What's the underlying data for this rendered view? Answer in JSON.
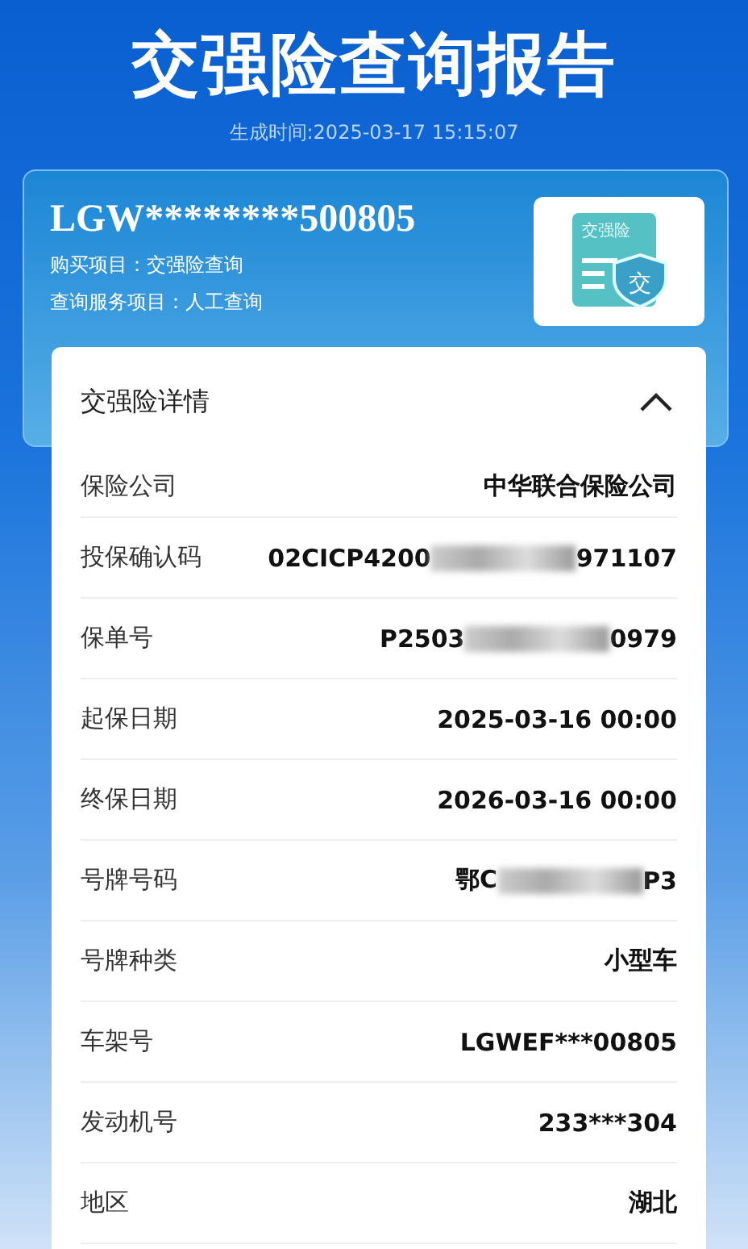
{
  "title": "交强险查询报告",
  "generated": "生成时间:2025-03-17 15:15:07",
  "summary": {
    "vin": "LGW********500805",
    "purchase": "购买项目：交强险查询",
    "service": "查询服务项目：人工查询",
    "badge": "交强险",
    "badge_glyph": "交"
  },
  "details": {
    "heading": "交强险详情",
    "expanded": true,
    "rows": [
      {
        "label": "保险公司",
        "value_parts": [
          "中华联合保险公司"
        ]
      },
      {
        "label": "投保确认码",
        "value_parts": [
          "02CICP4200",
          "971107"
        ]
      },
      {
        "label": "保单号",
        "value_parts": [
          "P2503",
          "0979"
        ]
      },
      {
        "label": "起保日期",
        "value_parts": [
          "2025-03-16 00:00"
        ]
      },
      {
        "label": "终保日期",
        "value_parts": [
          "2026-03-16 00:00"
        ]
      },
      {
        "label": "号牌号码",
        "value_parts": [
          "鄂C",
          "P3"
        ]
      },
      {
        "label": "号牌种类",
        "value_parts": [
          "小型车"
        ]
      },
      {
        "label": "车架号",
        "value_parts": [
          "LGWEF***00805"
        ]
      },
      {
        "label": "发动机号",
        "value_parts": [
          "233***304"
        ]
      },
      {
        "label": "地区",
        "value_parts": [
          "湖北"
        ]
      }
    ]
  }
}
